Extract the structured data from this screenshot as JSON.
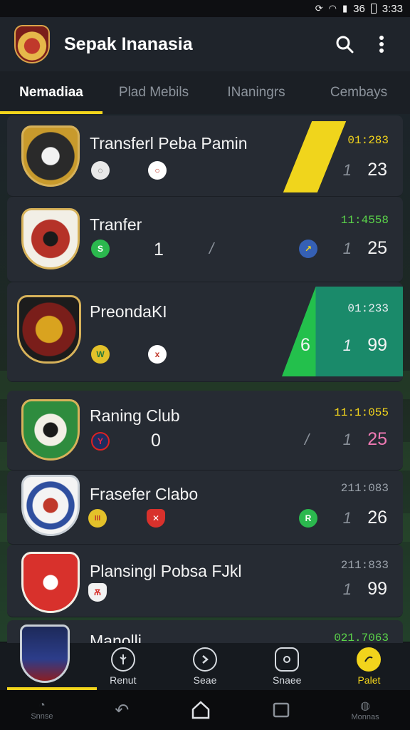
{
  "status": {
    "time": "3:33",
    "network": "36"
  },
  "app": {
    "title": "Sepak Inanasia"
  },
  "tabs": [
    {
      "label": "Nemadiaa",
      "active": true
    },
    {
      "label": "Plad Mebils",
      "active": false
    },
    {
      "label": "INaningrs",
      "active": false
    },
    {
      "label": "Cembays",
      "active": false
    }
  ],
  "matches": [
    {
      "name": "Transferl Peba Pamin",
      "time": "01:283",
      "time_color": "#f2d41c",
      "prefix": "1",
      "score": "23",
      "accent": "yellow-stripe",
      "crest_color": "#c89a2c",
      "left_mini": "◌",
      "mid_mini": "○"
    },
    {
      "name": "Tranfer",
      "time": "11:4558",
      "time_color": "#5bd44a",
      "home_count": "1",
      "prefix": "1",
      "score": "25",
      "crest_color": "#b53228",
      "left_mini": "S",
      "right_mini": "↗"
    },
    {
      "name": "PreondaKI",
      "time": "01:233",
      "time_color": "#e9edf2",
      "band_number": "6",
      "prefix": "1",
      "score": "99",
      "accent": "green-band",
      "crest_color": "#b47a1d",
      "left_mini": "W",
      "mid_mini": "x"
    },
    {
      "name": "Raning Club",
      "time": "11:1:055",
      "time_color": "#f2d41c",
      "home_count": "0",
      "prefix": "1",
      "score": "25",
      "score_color": "#f07ab4",
      "crest_color": "#2e8c3e",
      "left_mini": "Y"
    },
    {
      "name": "Frasefer Clabo",
      "time": "211:083",
      "time_color": "#9aa1aa",
      "prefix": "1",
      "score": "26",
      "crest_color": "#d0d6df",
      "left_mini": "III",
      "mid_mini": "✕",
      "right_mini": "R"
    },
    {
      "name": "Plansingl Pobsa FJkl",
      "time": "211:833",
      "time_color": "#9aa1aa",
      "prefix": "1",
      "score": "99",
      "crest_color": "#d8312c",
      "left_mini": "Ѫ"
    },
    {
      "name": "Manolli",
      "time": "021.7063",
      "time_color": "#5bd44a"
    }
  ],
  "bottom_nav": [
    {
      "label": "Renut",
      "icon": "gauge-icon"
    },
    {
      "label": "Seae",
      "icon": "arrow-circle-icon"
    },
    {
      "label": "Snaee",
      "icon": "gear-badge-icon"
    },
    {
      "label": "Palet",
      "icon": "ball-icon",
      "active": true
    }
  ],
  "system_nav": [
    {
      "label": "Snnse"
    },
    {
      "label": ""
    },
    {
      "label": ""
    },
    {
      "label": ""
    },
    {
      "label": "Monnas"
    }
  ]
}
